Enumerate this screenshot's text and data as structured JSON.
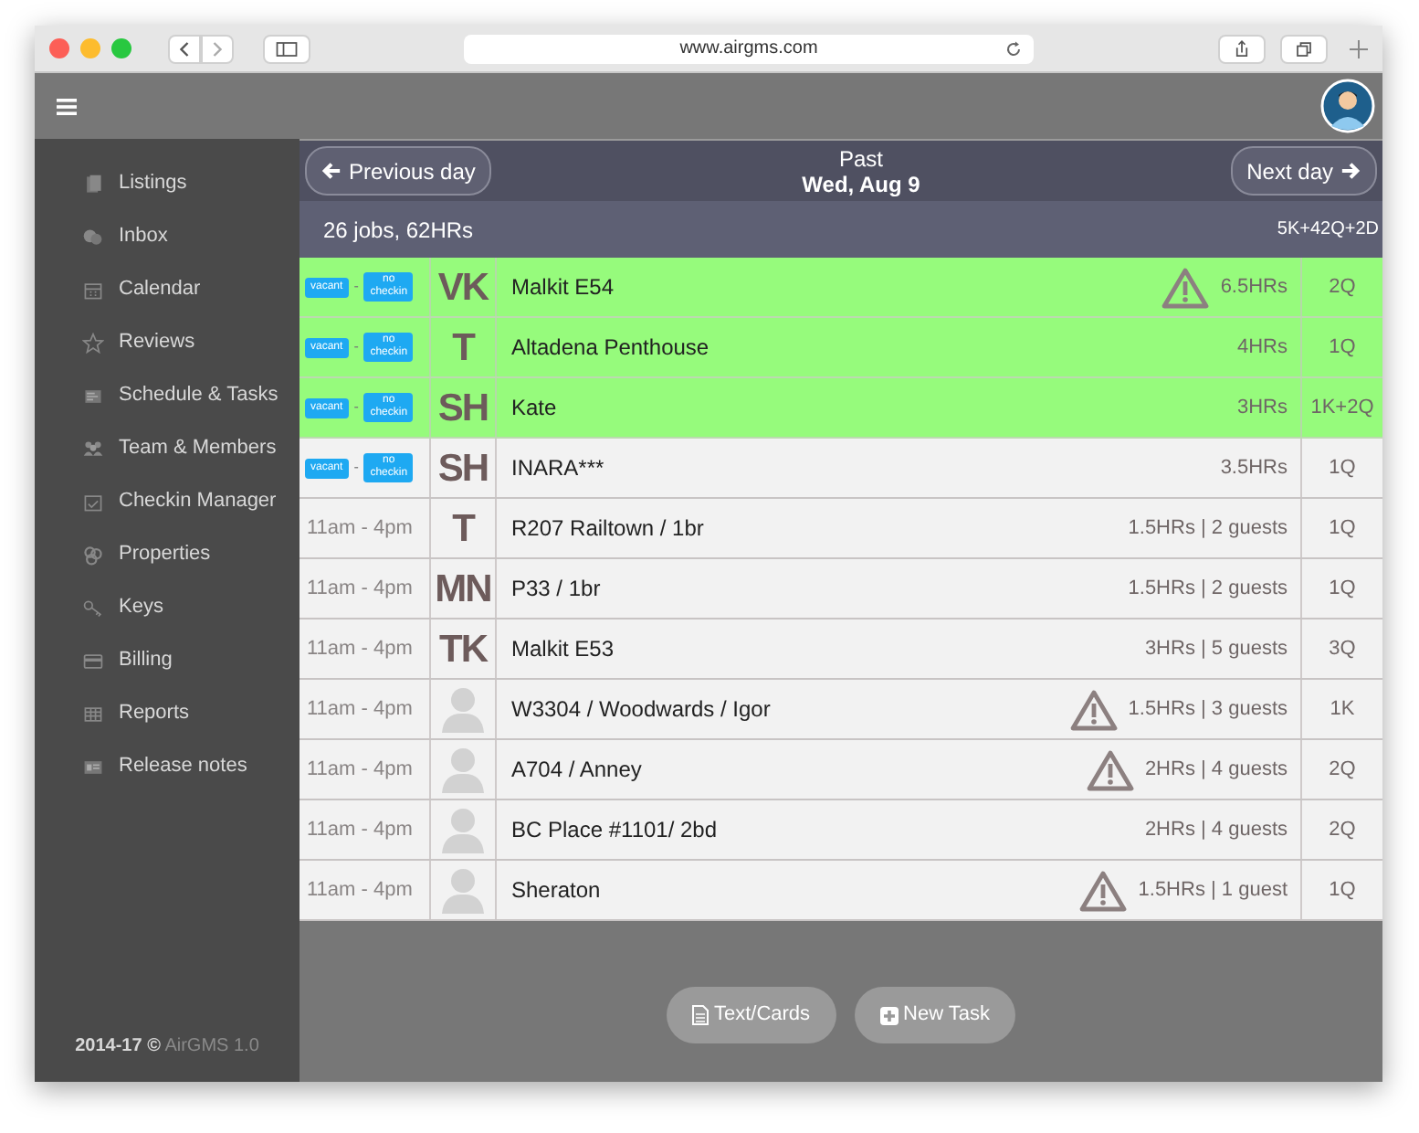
{
  "browser": {
    "url": "www.airgms.com"
  },
  "sidebar": {
    "items": [
      {
        "label": "Listings"
      },
      {
        "label": "Inbox"
      },
      {
        "label": "Calendar"
      },
      {
        "label": "Reviews"
      },
      {
        "label": "Schedule & Tasks"
      },
      {
        "label": "Team & Members"
      },
      {
        "label": "Checkin Manager"
      },
      {
        "label": "Properties"
      },
      {
        "label": "Keys"
      },
      {
        "label": "Billing"
      },
      {
        "label": "Reports"
      },
      {
        "label": "Release notes"
      }
    ],
    "footer": {
      "years": "2014-17 ©",
      "version": "AirGMS 1.0"
    }
  },
  "day_nav": {
    "previous": "Previous day",
    "period": "Past",
    "date": "Wed, Aug 9",
    "next": "Next day"
  },
  "summary": {
    "jobs": "26 jobs, 62HRs",
    "beds": "5K+42Q+2D"
  },
  "rows": [
    {
      "kind": "vacancy",
      "status": "vacant",
      "separator": "-",
      "checkin": "no checkin",
      "initials": "VK",
      "name": "Malkit E54",
      "warning": true,
      "info": "6.5HRs",
      "beds": "2Q",
      "highlighted": true
    },
    {
      "kind": "vacancy",
      "status": "vacant",
      "separator": "-",
      "checkin": "no checkin",
      "initials": "T",
      "name": "Altadena Penthouse",
      "warning": false,
      "info": "4HRs",
      "beds": "1Q",
      "highlighted": true
    },
    {
      "kind": "vacancy",
      "status": "vacant",
      "separator": "-",
      "checkin": "no checkin",
      "initials": "SH",
      "name": "Kate",
      "warning": false,
      "info": "3HRs",
      "beds": "1K+2Q",
      "highlighted": true
    },
    {
      "kind": "vacancy",
      "status": "vacant",
      "separator": "-",
      "checkin": "no checkin",
      "initials": "SH",
      "name": "INARA***",
      "warning": false,
      "info": "3.5HRs",
      "beds": "1Q",
      "highlighted": false
    },
    {
      "kind": "time",
      "time": "11am - 4pm",
      "initials": "T",
      "name": "R207 Railtown / 1br",
      "warning": false,
      "info": "1.5HRs | 2 guests",
      "beds": "1Q",
      "highlighted": false
    },
    {
      "kind": "time",
      "time": "11am - 4pm",
      "initials": "MN",
      "name": "P33 / 1br",
      "warning": false,
      "info": "1.5HRs | 2 guests",
      "beds": "1Q",
      "highlighted": false
    },
    {
      "kind": "time",
      "time": "11am - 4pm",
      "initials": "TK",
      "name": "Malkit E53",
      "warning": false,
      "info": "3HRs | 5 guests",
      "beds": "3Q",
      "highlighted": false
    },
    {
      "kind": "time",
      "time": "11am - 4pm",
      "name": "W3304 / Woodwards / Igor",
      "warning": true,
      "info": "1.5HRs | 3 guests",
      "beds": "1K",
      "highlighted": false
    },
    {
      "kind": "time",
      "time": "11am - 4pm",
      "name": "A704 / Anney",
      "warning": true,
      "info": "2HRs | 4 guests",
      "beds": "2Q",
      "highlighted": false
    },
    {
      "kind": "time",
      "time": "11am - 4pm",
      "name": "BC Place #1101/ 2bd",
      "warning": false,
      "info": "2HRs | 4 guests",
      "beds": "2Q",
      "highlighted": false
    },
    {
      "kind": "time",
      "time": "11am - 4pm",
      "name": "Sheraton",
      "warning": true,
      "info": "1.5HRs | 1 guest",
      "beds": "1Q",
      "highlighted": false
    }
  ],
  "actions": [
    {
      "label": "Text/Cards"
    },
    {
      "label": "New Task"
    }
  ]
}
